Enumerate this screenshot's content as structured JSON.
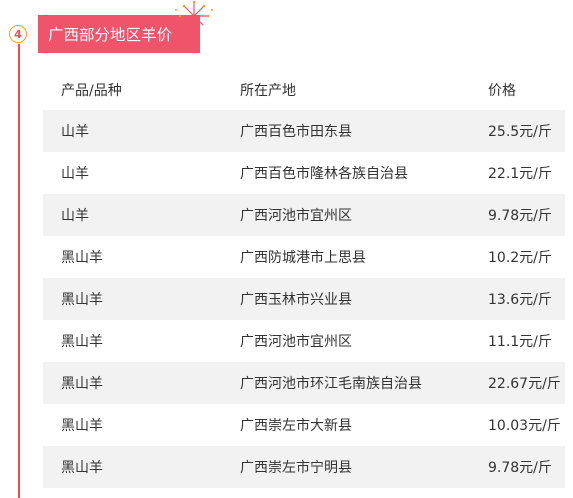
{
  "section": {
    "step_number": "4",
    "title": "广西部分地区羊价"
  },
  "table": {
    "headers": [
      "产品/品种",
      "所在产地",
      "价格"
    ],
    "rows": [
      [
        "山羊",
        "广西百色市田东县",
        "25.5元/斤"
      ],
      [
        "山羊",
        "广西百色市隆林各族自治县",
        "22.1元/斤"
      ],
      [
        "山羊",
        "广西河池市宜州区",
        "9.78元/斤"
      ],
      [
        "黑山羊",
        "广西防城港市上思县",
        "10.2元/斤"
      ],
      [
        "黑山羊",
        "广西玉林市兴业县",
        "13.6元/斤"
      ],
      [
        "黑山羊",
        "广西河池市宜州区",
        "11.1元/斤"
      ],
      [
        "黑山羊",
        "广西河池市环江毛南族自治县",
        "22.67元/斤"
      ],
      [
        "黑山羊",
        "广西崇左市大新县",
        "10.03元/斤"
      ],
      [
        "黑山羊",
        "广西崇左市宁明县",
        "9.78元/斤"
      ]
    ]
  },
  "colors": {
    "accent": "#f0546a",
    "timeline": "#e8505b",
    "circle_border": "#f0a030",
    "row_shade": "#f2f2f2"
  },
  "icons": {
    "decoration": "firework-icon"
  }
}
